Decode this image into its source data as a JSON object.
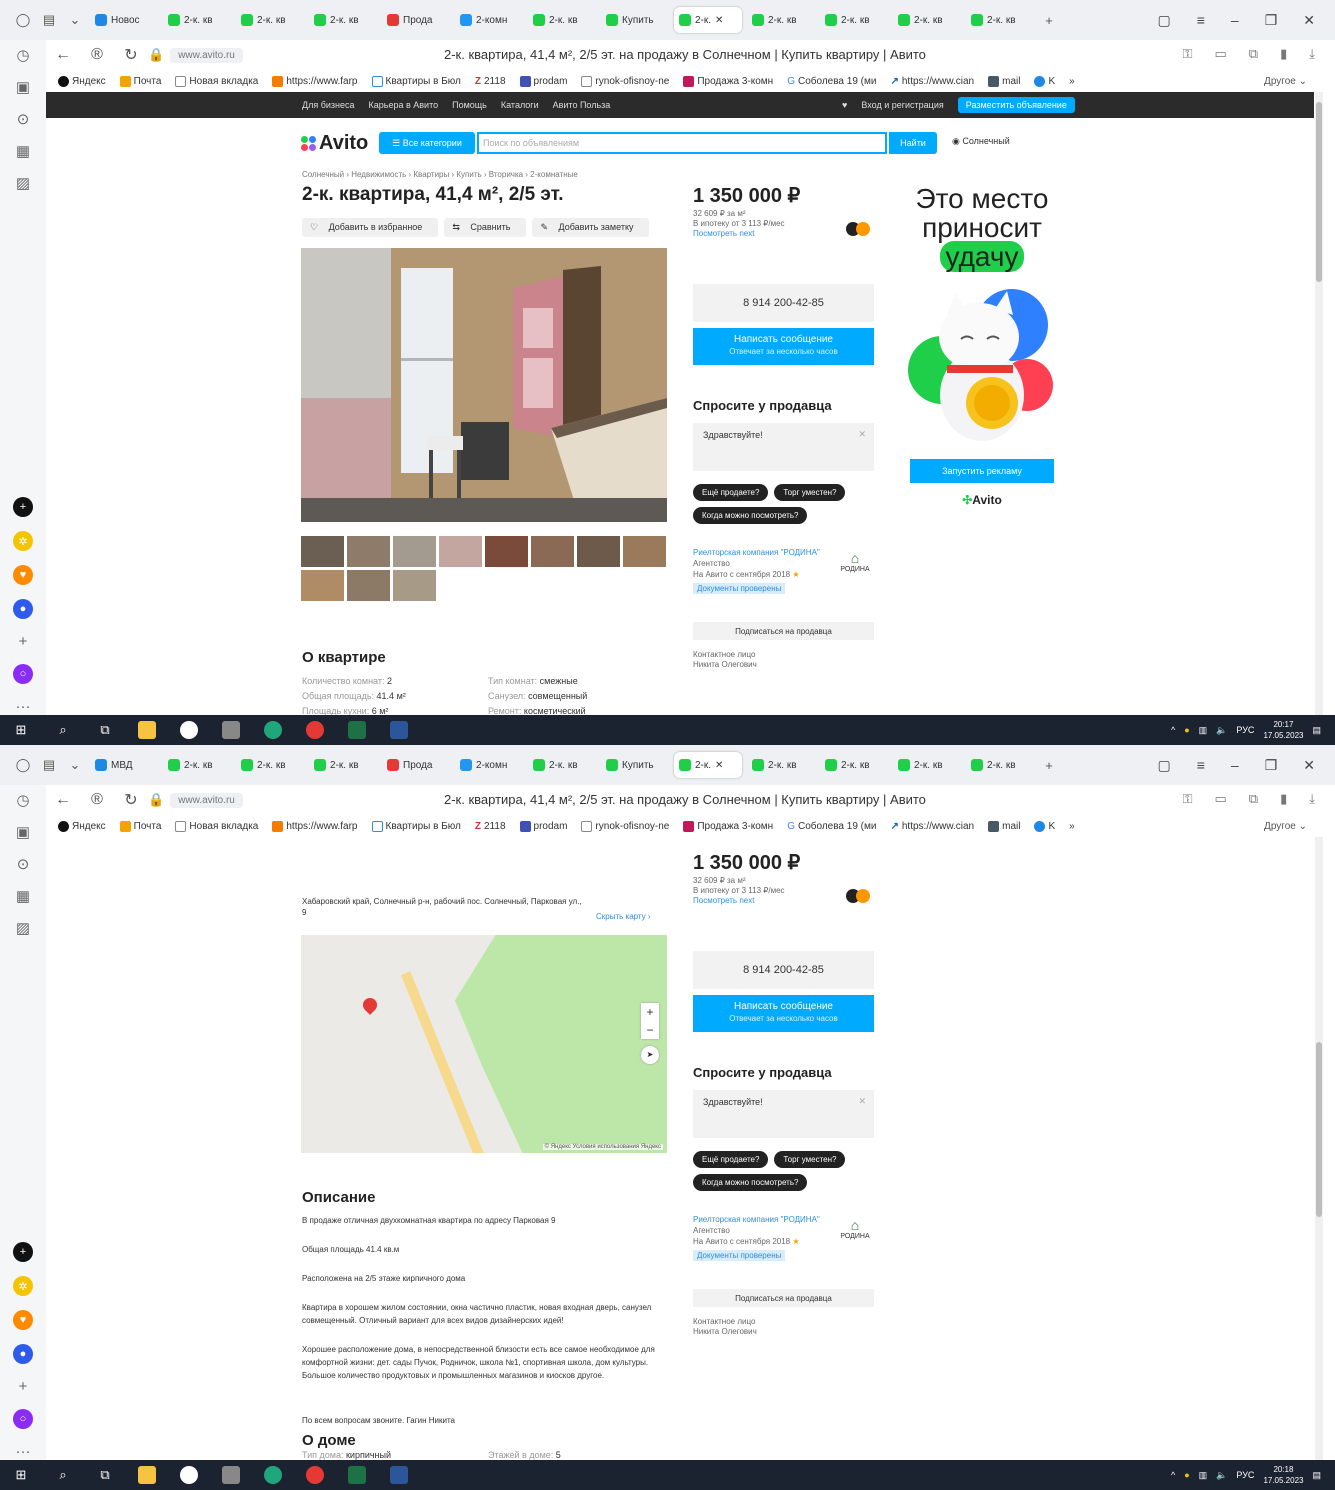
{
  "browser": {
    "tabs": [
      "Новос",
      "2-к. кв",
      "2-к. кв",
      "2-к. кв",
      "Прода",
      "2-комн",
      "2-к. кв",
      "Купить",
      "2-к.",
      "2-к. кв",
      "2-к. кв",
      "2-к. кв",
      "2-к. кв"
    ],
    "tabs_s2": [
      "МВД",
      "2-к. кв",
      "2-к. кв",
      "2-к. кв",
      "Прода",
      "2-комн",
      "2-к. кв",
      "Купить",
      "2-к.",
      "2-к. кв",
      "2-к. кв",
      "2-к. кв",
      "2-к. кв"
    ],
    "host": "www.avito.ru",
    "page_title": "2-к. квартира, 41,4 м², 2/5 эт. на продажу в Солнечном | Купить квартиру | Авито",
    "bookmarks": [
      "Яндекс",
      "Почта",
      "Новая вкладка",
      "https://www.farp",
      "Квартиры в Бюл",
      "2118",
      "prodam",
      "rynok-ofisnoy-ne",
      "Продажа 3-комн",
      "Соболева 19 (ми",
      "https://www.cian",
      "mail",
      "K"
    ],
    "other_bookmarks": "Другое"
  },
  "site": {
    "topnav": [
      "Для бизнеса",
      "Карьера в Авито",
      "Помощь",
      "Каталоги",
      "Авито Польза"
    ],
    "login": "Вход и регистрация",
    "post_ad": "Разместить объявление",
    "logo": "Avito",
    "all_categories": "Все категории",
    "search_placeholder": "Поиск по объявлениям",
    "find": "Найти",
    "location": "Солнечный"
  },
  "listing": {
    "breadcrumbs": "Солнечный › Недвижимость › Квартиры › Купить › Вторичка › 2-комнатные",
    "title": "2-к. квартира, 41,4 м², 2/5 эт.",
    "actions": [
      "Добавить в избранное",
      "Сравнить",
      "Добавить заметку"
    ],
    "about_title": "О квартире",
    "about_left": [
      {
        "k": "Количество комнат:",
        "v": "2"
      },
      {
        "k": "Общая площадь:",
        "v": "41.4 м²"
      },
      {
        "k": "Площадь кухни:",
        "v": "6 м²"
      }
    ],
    "about_right": [
      {
        "k": "Тип комнат:",
        "v": "смежные"
      },
      {
        "k": "Санузел:",
        "v": "совмещенный"
      },
      {
        "k": "Ремонт:",
        "v": "косметический"
      }
    ],
    "address": "Хабаровский край, Солнечный р-н, рабочий пос. Солнечный, Парковая ул., 9",
    "show_map": "Скрыть карту",
    "map_copy": "© Яндекс  Условия использования  Яндекс",
    "desc_title": "Описание",
    "desc_paragraphs": [
      "В продаже отличная двухкомнатная квартира по адресу Парковая 9",
      "Общая площадь 41.4 кв.м",
      "Расположена на 2/5 этаже кирпичного дома",
      "Квартира в хорошем жилом состоянии, окна частично пластик, новая входная дверь, санузел совмещенный. Отличный вариант для всех видов дизайнерских идей!",
      "Хорошее расположение дома, в непосредственной близости есть все самое необходимое для комфортной жизни: дет. сады Пучок, Родничок, школа №1, спортивная школа, дом культуры. Большое количество продуктовых и промышленных магазинов и киосков другое.",
      "По всем вопросам звоните. Гагин Никита"
    ],
    "house_title": "О доме",
    "house_left": {
      "k": "Тип дома:",
      "v": "кирпичный"
    },
    "house_right": {
      "k": "Этажей в доме:",
      "v": "5"
    }
  },
  "sidebar": {
    "price": "1 350 000 ₽",
    "price_per_m": "32 609 ₽ за м²",
    "mortgage": "В ипотеку от 3 113 ₽/мес",
    "mortgage_link": "Посмотреть next",
    "phone": "8 914 200-42-85",
    "write": "Написать сообщение",
    "write_sub": "Отвечает за несколько часов",
    "ask_title": "Спросите у продавца",
    "ask_text": "Здравствуйте!",
    "chips": [
      "Ещё продаете?",
      "Торг уместен?",
      "Когда можно посмотреть?"
    ],
    "seller_name": "Риелторская компания \"РОДИНА\"",
    "seller_type": "Агентство",
    "seller_since": "На Авито с сентября 2018",
    "seller_badge": "Документы проверены",
    "seller_logo": "РОДИНА",
    "subscribe": "Подписаться на продавца",
    "contact_label": "Контактное лицо",
    "contact_name": "Никита Олегович"
  },
  "ad": {
    "line1": "Это место",
    "line2": "приносит",
    "line3": "удачу",
    "button": "Запустить рекламу",
    "logo": "Avito"
  },
  "taskbar": {
    "lang": "РУС",
    "time1": "20:17",
    "date": "17.05.2023",
    "time2": "20:18"
  },
  "colors": {
    "accent": "#00aaff",
    "avito_green": "#1fcf4a",
    "taskbar": "#1b2230"
  }
}
